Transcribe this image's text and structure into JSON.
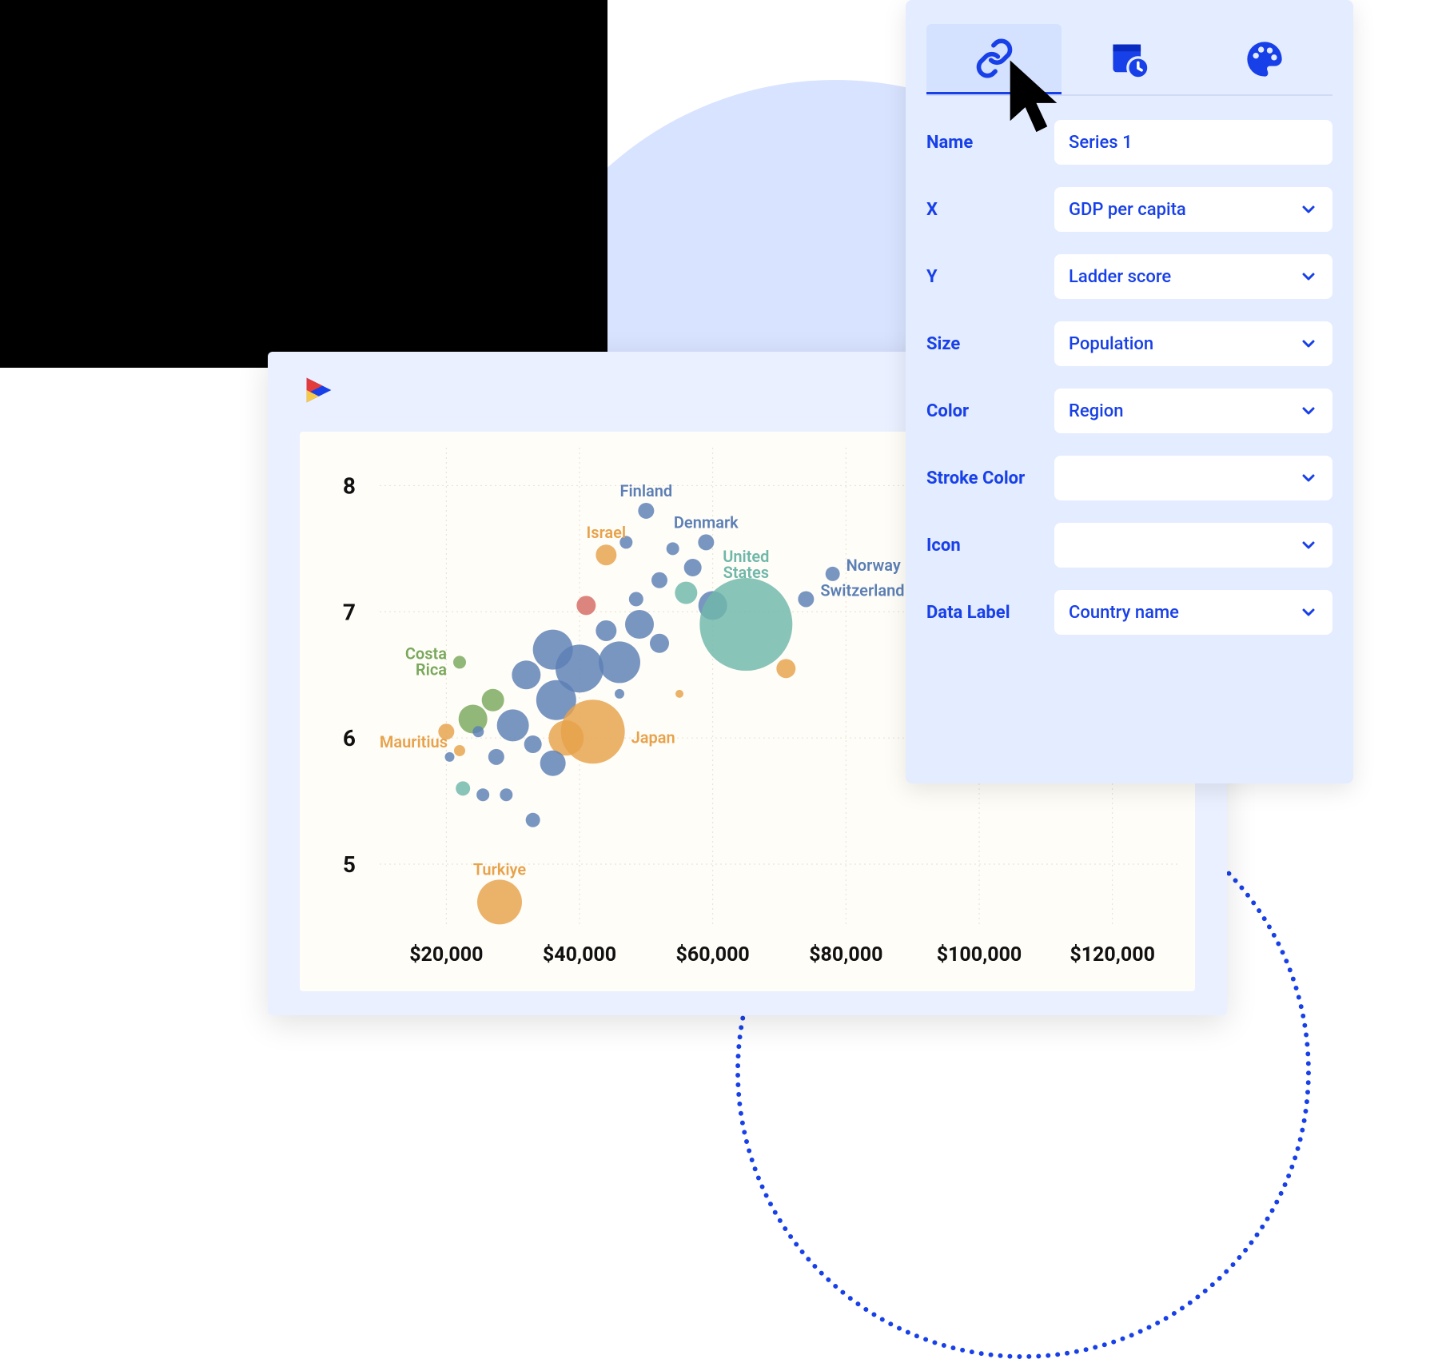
{
  "panel": {
    "tabs": [
      "link",
      "schedule",
      "style"
    ],
    "activeTab": 0,
    "fields": {
      "name": {
        "label": "Name",
        "value": "Series 1",
        "type": "text"
      },
      "x": {
        "label": "X",
        "value": "GDP per capita",
        "type": "select"
      },
      "y": {
        "label": "Y",
        "value": "Ladder score",
        "type": "select"
      },
      "size": {
        "label": "Size",
        "value": "Population",
        "type": "select"
      },
      "color": {
        "label": "Color",
        "value": "Region",
        "type": "select"
      },
      "strokeColor": {
        "label": "Stroke Color",
        "value": "",
        "type": "select"
      },
      "icon": {
        "label": "Icon",
        "value": "",
        "type": "select"
      },
      "dataLabel": {
        "label": "Data Label",
        "value": "Country name",
        "type": "select"
      }
    }
  },
  "chart_data": {
    "type": "scatter",
    "title": "",
    "xlabel": "",
    "ylabel": "",
    "x_prefix": "$",
    "x_ticks": [
      20000,
      40000,
      60000,
      80000,
      100000,
      120000
    ],
    "x_tick_labels": [
      "$20,000",
      "$40,000",
      "$60,000",
      "$80,000",
      "$100,000",
      "$120,000"
    ],
    "y_ticks": [
      5,
      6,
      7,
      8
    ],
    "xlim": [
      10000,
      130000
    ],
    "ylim": [
      4.5,
      8.3
    ],
    "size_field": "Population",
    "color_field": "Region",
    "region_colors": {
      "blue": "#5b7fb5",
      "teal": "#6fb7a9",
      "orange": "#e7a24a",
      "green": "#79a85b",
      "red": "#d46a63"
    },
    "labeled_points": [
      {
        "name": "Finland",
        "x": 50000,
        "y": 7.8,
        "r": 10,
        "color": "blue"
      },
      {
        "name": "Denmark",
        "x": 59000,
        "y": 7.55,
        "r": 10,
        "color": "blue"
      },
      {
        "name": "Israel",
        "x": 44000,
        "y": 7.45,
        "r": 13,
        "color": "orange"
      },
      {
        "name": "Norway",
        "x": 78000,
        "y": 7.3,
        "r": 9,
        "color": "blue"
      },
      {
        "name": "United States",
        "x": 65000,
        "y": 6.9,
        "r": 58,
        "color": "teal"
      },
      {
        "name": "Switzerland",
        "x": 74000,
        "y": 7.1,
        "r": 10,
        "color": "blue"
      },
      {
        "name": "Costa Rica",
        "x": 22000,
        "y": 6.6,
        "r": 8,
        "color": "green"
      },
      {
        "name": "Japan",
        "x": 42000,
        "y": 6.05,
        "r": 40,
        "color": "orange"
      },
      {
        "name": "Mauritius",
        "x": 22000,
        "y": 5.9,
        "r": 7,
        "color": "orange"
      },
      {
        "name": "Turkiye",
        "x": 28000,
        "y": 4.7,
        "r": 28,
        "color": "orange"
      }
    ],
    "unlabeled_points": [
      {
        "x": 47000,
        "y": 7.55,
        "r": 8,
        "color": "blue"
      },
      {
        "x": 54000,
        "y": 7.5,
        "r": 8,
        "color": "blue"
      },
      {
        "x": 57000,
        "y": 7.35,
        "r": 11,
        "color": "blue"
      },
      {
        "x": 52000,
        "y": 7.25,
        "r": 10,
        "color": "blue"
      },
      {
        "x": 56000,
        "y": 7.15,
        "r": 14,
        "color": "teal"
      },
      {
        "x": 48500,
        "y": 7.1,
        "r": 9,
        "color": "blue"
      },
      {
        "x": 60000,
        "y": 7.05,
        "r": 18,
        "color": "blue"
      },
      {
        "x": 41000,
        "y": 7.05,
        "r": 12,
        "color": "red"
      },
      {
        "x": 49000,
        "y": 6.9,
        "r": 18,
        "color": "blue"
      },
      {
        "x": 44000,
        "y": 6.85,
        "r": 13,
        "color": "blue"
      },
      {
        "x": 52000,
        "y": 6.75,
        "r": 12,
        "color": "blue"
      },
      {
        "x": 36000,
        "y": 6.7,
        "r": 25,
        "color": "blue"
      },
      {
        "x": 46000,
        "y": 6.6,
        "r": 26,
        "color": "blue"
      },
      {
        "x": 40000,
        "y": 6.55,
        "r": 30,
        "color": "blue"
      },
      {
        "x": 71000,
        "y": 6.55,
        "r": 12,
        "color": "orange"
      },
      {
        "x": 32000,
        "y": 6.5,
        "r": 18,
        "color": "blue"
      },
      {
        "x": 46000,
        "y": 6.35,
        "r": 6,
        "color": "blue"
      },
      {
        "x": 55000,
        "y": 6.35,
        "r": 5,
        "color": "orange"
      },
      {
        "x": 36500,
        "y": 6.3,
        "r": 25,
        "color": "blue"
      },
      {
        "x": 27000,
        "y": 6.3,
        "r": 14,
        "color": "green"
      },
      {
        "x": 24000,
        "y": 6.15,
        "r": 18,
        "color": "green"
      },
      {
        "x": 30000,
        "y": 6.1,
        "r": 20,
        "color": "blue"
      },
      {
        "x": 20000,
        "y": 6.05,
        "r": 10,
        "color": "orange"
      },
      {
        "x": 24800,
        "y": 6.05,
        "r": 7,
        "color": "blue"
      },
      {
        "x": 38000,
        "y": 6.0,
        "r": 22,
        "color": "orange"
      },
      {
        "x": 33000,
        "y": 5.95,
        "r": 11,
        "color": "blue"
      },
      {
        "x": 36000,
        "y": 5.8,
        "r": 16,
        "color": "blue"
      },
      {
        "x": 27500,
        "y": 5.85,
        "r": 10,
        "color": "blue"
      },
      {
        "x": 20500,
        "y": 5.85,
        "r": 6,
        "color": "blue"
      },
      {
        "x": 22500,
        "y": 5.6,
        "r": 9,
        "color": "teal"
      },
      {
        "x": 25500,
        "y": 5.55,
        "r": 8,
        "color": "blue"
      },
      {
        "x": 29000,
        "y": 5.55,
        "r": 8,
        "color": "blue"
      },
      {
        "x": 33000,
        "y": 5.35,
        "r": 9,
        "color": "blue"
      }
    ]
  }
}
